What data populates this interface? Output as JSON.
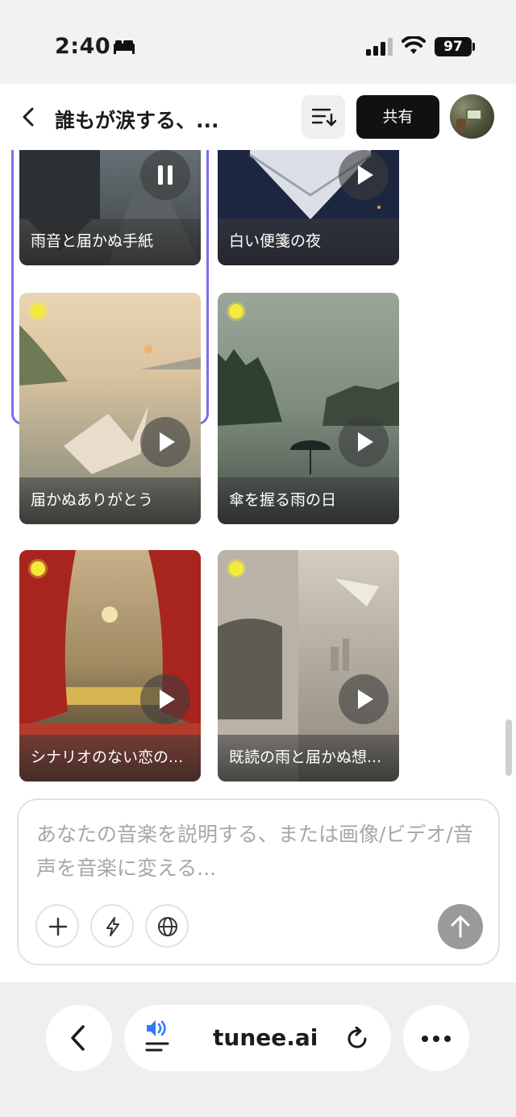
{
  "status_bar": {
    "time": "2:40",
    "battery": "97"
  },
  "header": {
    "title": "誰もが涙する、...",
    "share_label": "共有"
  },
  "cards": [
    {
      "title": "雨音と届かぬ手紙",
      "state": "playing",
      "selected": true
    },
    {
      "title": "白い便箋の夜",
      "state": "paused",
      "selected": false
    },
    {
      "title": "届かぬありがとう",
      "state": "paused",
      "new": true
    },
    {
      "title": "傘を握る雨の日",
      "state": "paused",
      "new": true
    },
    {
      "title": "シナリオのない恋の...",
      "state": "paused",
      "new": true
    },
    {
      "title": "既読の雨と届かぬ想...",
      "state": "paused",
      "new": true
    }
  ],
  "composer": {
    "placeholder": "あなたの音楽を説明する、または画像/ビデオ/音声を音楽に変える..."
  },
  "browser": {
    "url": "tunee.ai"
  },
  "colors": {
    "selected_border": "#7b6ef2",
    "new_dot": "#f3ea3c",
    "share_bg": "#111111",
    "audio_icon": "#2f7cf6"
  }
}
